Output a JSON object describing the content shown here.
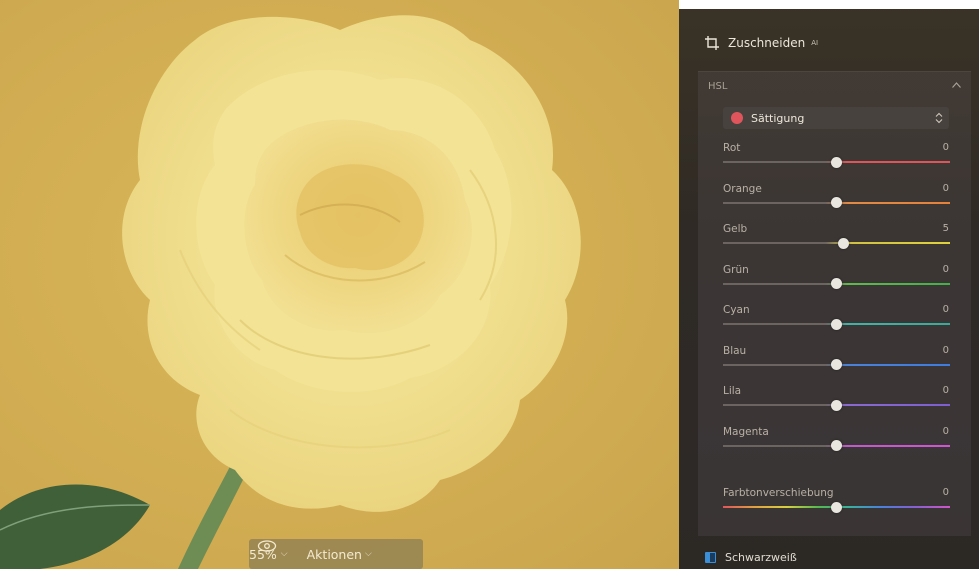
{
  "canvas": {
    "zoom_label": "55%",
    "actions_label": "Aktionen"
  },
  "panel": {
    "crop_label": "Zuschneiden",
    "crop_badge": "AI",
    "hsl": {
      "title": "HSL",
      "mode": "Sättigung",
      "mode_color": "#e0555c",
      "sliders": [
        {
          "label": "Rot",
          "value": "0",
          "fraction": 0.5,
          "colors": [
            "#e0555c",
            "#e0555c"
          ]
        },
        {
          "label": "Orange",
          "value": "0",
          "fraction": 0.5,
          "colors": [
            "#e08a45",
            "#e6823a"
          ]
        },
        {
          "label": "Gelb",
          "value": "5",
          "fraction": 0.53,
          "colors": [
            "#cfc043",
            "#e0d23c"
          ]
        },
        {
          "label": "Grün",
          "value": "0",
          "fraction": 0.5,
          "colors": [
            "#5fb94e",
            "#43b04a"
          ]
        },
        {
          "label": "Cyan",
          "value": "0",
          "fraction": 0.5,
          "colors": [
            "#41b3a6",
            "#3aaa98"
          ]
        },
        {
          "label": "Blau",
          "value": "0",
          "fraction": 0.5,
          "colors": [
            "#4a82d8",
            "#3f7ce0"
          ]
        },
        {
          "label": "Lila",
          "value": "0",
          "fraction": 0.5,
          "colors": [
            "#8a6ad0",
            "#7d5fd1"
          ]
        },
        {
          "label": "Magenta",
          "value": "0",
          "fraction": 0.5,
          "colors": [
            "#c05ac9",
            "#d056d2"
          ]
        }
      ],
      "hue_shift": {
        "label": "Farbtonverschiebung",
        "value": "0",
        "fraction": 0.5
      }
    },
    "bw_label": "Schwarzweiß"
  },
  "icons": {
    "crop": "crop-icon",
    "eye": "eye-icon",
    "caret_up": "chevron-up-icon",
    "select_updown": "updown-icon",
    "bw": "black-white-icon"
  }
}
